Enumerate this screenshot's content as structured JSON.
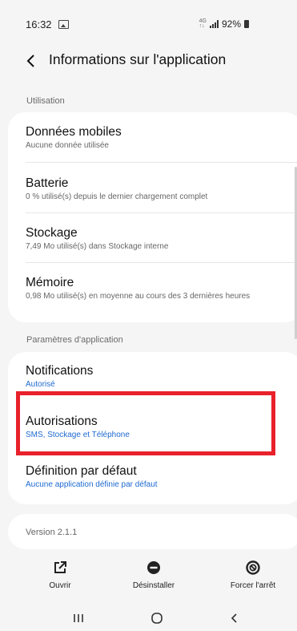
{
  "status_bar": {
    "time": "16:32",
    "network_top": "4G",
    "network_bottom": "↑↓",
    "battery": "92%"
  },
  "header": {
    "title": "Informations sur l'application"
  },
  "sections": {
    "usage_label": "Utilisation",
    "app_settings_label": "Paramètres d'application"
  },
  "usage_items": [
    {
      "title": "Données mobiles",
      "subtitle": "Aucune donnée utilisée"
    },
    {
      "title": "Batterie",
      "subtitle": "0 % utilisé(s) depuis le dernier chargement complet"
    },
    {
      "title": "Stockage",
      "subtitle": "7,49 Mo utilisé(s) dans Stockage interne"
    },
    {
      "title": "Mémoire",
      "subtitle": "0,98 Mo utilisé(s) en moyenne au cours des 3 dernières heures"
    }
  ],
  "settings_items": [
    {
      "title": "Notifications",
      "subtitle": "Autorisé"
    },
    {
      "title": "Autorisations",
      "subtitle": "SMS, Stockage et Téléphone"
    },
    {
      "title": "Définition par défaut",
      "subtitle": "Aucune application définie par défaut"
    }
  ],
  "version": "Version 2.1.1",
  "actions": {
    "open_label": "Ouvrir",
    "uninstall_label": "Désinstaller",
    "force_stop_label": "Forcer l'arrêt"
  },
  "icons": {
    "back": "chevron-left-icon",
    "open": "open-external-icon",
    "uninstall": "minus-circle-icon",
    "force_stop": "block-circle-icon",
    "nav_recents": "recents-icon",
    "nav_home": "home-icon",
    "nav_back": "back-icon"
  },
  "colors": {
    "accent": "#1e6ad0",
    "highlight": "#e8212b",
    "background": "#f5f5f5",
    "card": "#ffffff"
  }
}
